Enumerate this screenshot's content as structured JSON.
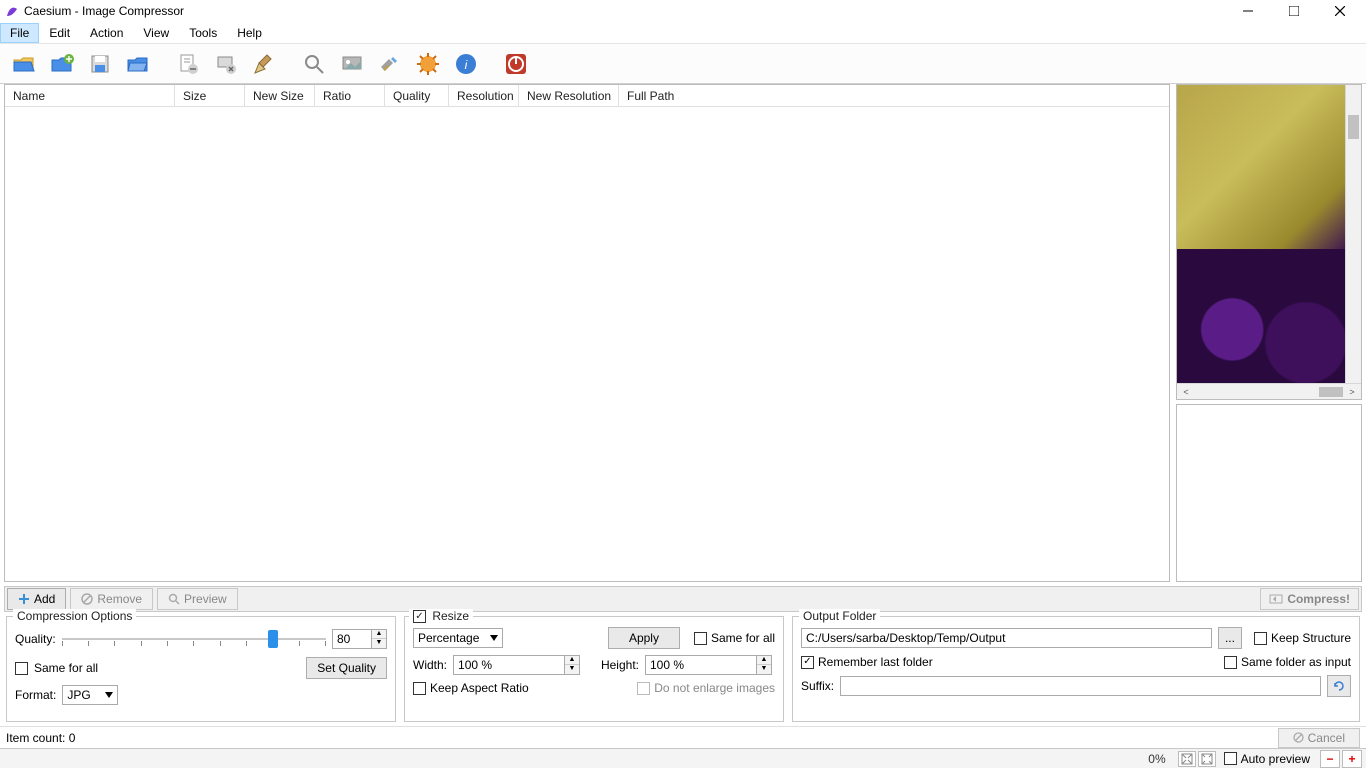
{
  "window": {
    "title": "Caesium - Image Compressor"
  },
  "menu": {
    "file": "File",
    "edit": "Edit",
    "action": "Action",
    "view": "View",
    "tools": "Tools",
    "help": "Help"
  },
  "toolbar": {
    "open": "open",
    "add_folder": "add-folder",
    "save_list": "save-list",
    "open_list": "open-list",
    "remove_item": "remove-item",
    "clear_list": "clear-list",
    "clean": "clean",
    "zoom": "zoom",
    "preview": "preview",
    "settings": "settings",
    "donate": "donate",
    "about": "about",
    "exit": "exit"
  },
  "list": {
    "headers": {
      "name": "Name",
      "size": "Size",
      "new_size": "New Size",
      "ratio": "Ratio",
      "quality": "Quality",
      "resolution": "Resolution",
      "new_resolution": "New Resolution",
      "full_path": "Full Path"
    },
    "rows": []
  },
  "mid": {
    "add": "Add",
    "remove": "Remove",
    "preview": "Preview",
    "compress": "Compress!"
  },
  "compression": {
    "legend": "Compression Options",
    "quality_label": "Quality:",
    "quality_value": "80",
    "set_quality": "Set Quality",
    "same_for_all": "Same for all",
    "format_label": "Format:",
    "format_value": "JPG"
  },
  "resize": {
    "resize_label": "Resize",
    "mode": "Percentage",
    "apply": "Apply",
    "same_for_all": "Same for all",
    "width_label": "Width:",
    "width_value": "100 %",
    "height_label": "Height:",
    "height_value": "100 %",
    "keep_aspect": "Keep Aspect Ratio",
    "no_enlarge": "Do not enlarge images"
  },
  "output": {
    "legend": "Output Folder",
    "path": "C:/Users/sarba/Desktop/Temp/Output",
    "browse": "...",
    "keep_structure": "Keep Structure",
    "remember": "Remember last folder",
    "same_as_input": "Same folder as input",
    "suffix_label": "Suffix:",
    "suffix_value": ""
  },
  "footer": {
    "item_count_label": "Item count: 0",
    "cancel": "Cancel",
    "percent": "0%",
    "auto_preview": "Auto preview"
  }
}
